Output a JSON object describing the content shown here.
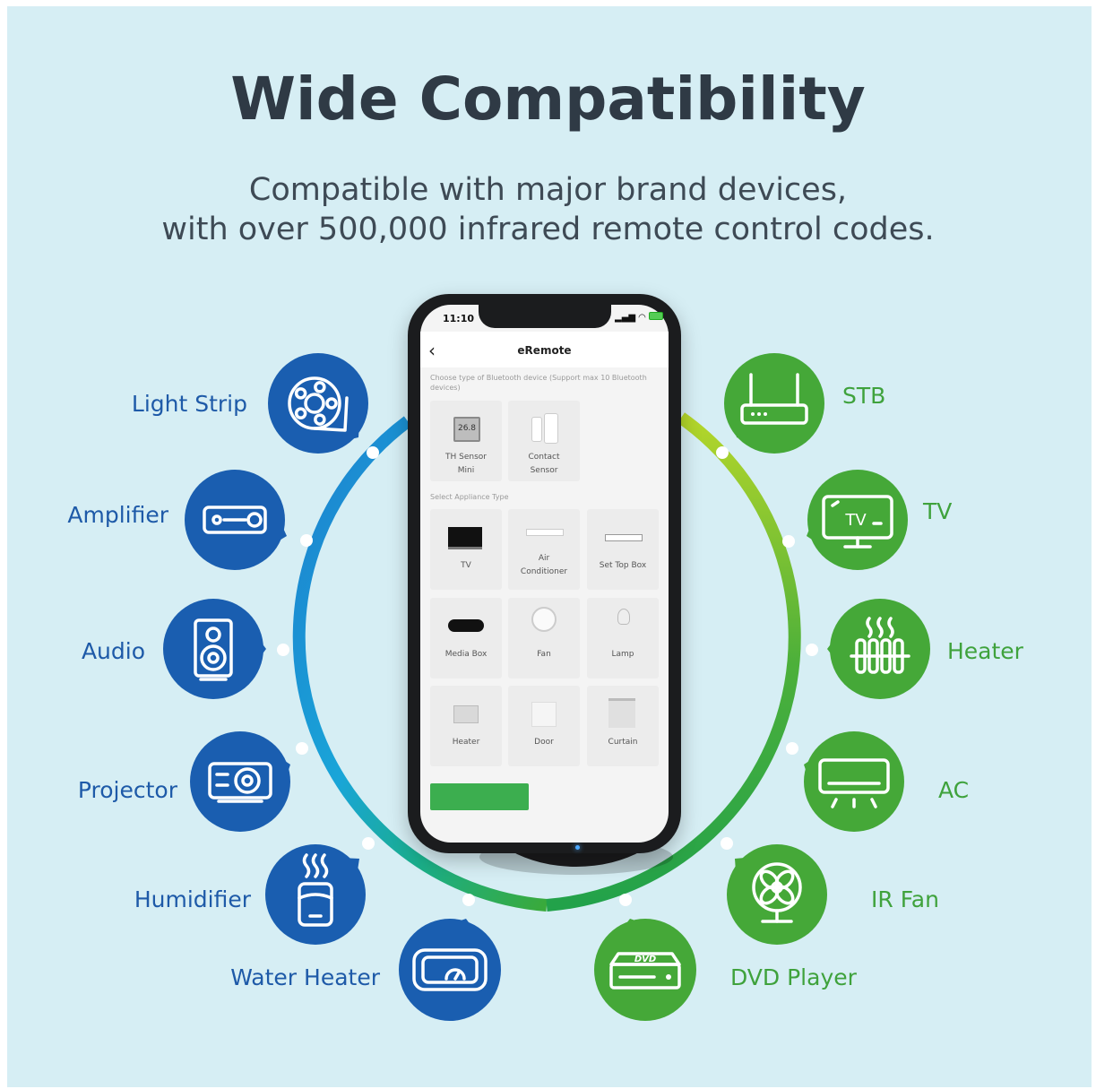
{
  "header": {
    "title": "Wide Compatibility",
    "subtitle_line1": "Compatible with major brand devices,",
    "subtitle_line2": "with over 500,000 infrared remote control codes."
  },
  "colors": {
    "background": "#d6eef4",
    "blue": "#1e5aa8",
    "green": "#3fa23c"
  },
  "left_devices": [
    {
      "label": "Light Strip",
      "icon": "light-strip-icon"
    },
    {
      "label": "Amplifier",
      "icon": "amplifier-icon"
    },
    {
      "label": "Audio",
      "icon": "speaker-icon"
    },
    {
      "label": "Projector",
      "icon": "projector-icon"
    },
    {
      "label": "Humidifier",
      "icon": "humidifier-icon"
    },
    {
      "label": "Water Heater",
      "icon": "water-heater-icon"
    }
  ],
  "right_devices": [
    {
      "label": "STB",
      "icon": "router-icon"
    },
    {
      "label": "TV",
      "icon": "tv-icon"
    },
    {
      "label": "Heater",
      "icon": "heater-icon"
    },
    {
      "label": "AC",
      "icon": "air-conditioner-icon"
    },
    {
      "label": "IR Fan",
      "icon": "fan-icon"
    },
    {
      "label": "DVD Player",
      "icon": "dvd-player-icon"
    }
  ],
  "phone": {
    "time": "11:10",
    "app_title": "eRemote",
    "bluetooth_prompt": "Choose type of Bluetooth device (Support max 10 Bluetooth devices)",
    "bluetooth_devices": [
      {
        "line1": "TH Sensor",
        "line2": "Mini"
      },
      {
        "line1": "Contact",
        "line2": "Sensor"
      }
    ],
    "appliance_prompt": "Select Appliance Type",
    "appliances": [
      {
        "line1": "TV",
        "line2": ""
      },
      {
        "line1": "Air",
        "line2": "Conditioner"
      },
      {
        "line1": "Set Top Box",
        "line2": ""
      },
      {
        "line1": "Media Box",
        "line2": ""
      },
      {
        "line1": "Fan",
        "line2": ""
      },
      {
        "line1": "Lamp",
        "line2": ""
      },
      {
        "line1": "Heater",
        "line2": ""
      },
      {
        "line1": "Door",
        "line2": ""
      },
      {
        "line1": "Curtain",
        "line2": ""
      }
    ]
  }
}
